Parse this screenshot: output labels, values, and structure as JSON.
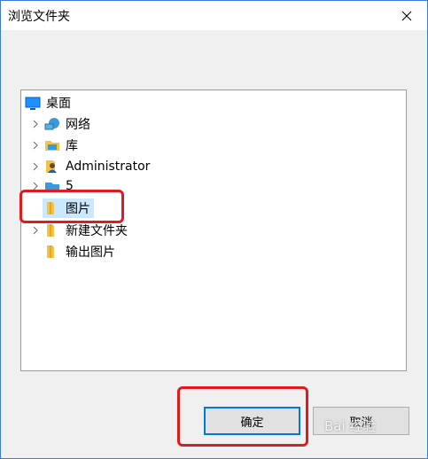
{
  "window": {
    "title": "浏览文件夹"
  },
  "tree": {
    "items": [
      {
        "label": "桌面",
        "icon": "desktop-icon"
      },
      {
        "label": "网络",
        "icon": "network-icon"
      },
      {
        "label": "库",
        "icon": "library-icon"
      },
      {
        "label": "Administrator",
        "icon": "user-folder-icon"
      },
      {
        "label": "5",
        "icon": "drive-icon"
      },
      {
        "label": "图片",
        "icon": "folder-icon",
        "selected": true
      },
      {
        "label": "新建文件夹",
        "icon": "folder-icon"
      },
      {
        "label": "输出图片",
        "icon": "folder-icon"
      }
    ]
  },
  "buttons": {
    "ok": "确定",
    "cancel": "取消"
  },
  "watermark": {
    "text": "Bai 经验"
  },
  "colors": {
    "accent": "#0078d7",
    "selection": "#cce8ff",
    "annotation": "#e11b1b",
    "folder": "#f5c342"
  }
}
